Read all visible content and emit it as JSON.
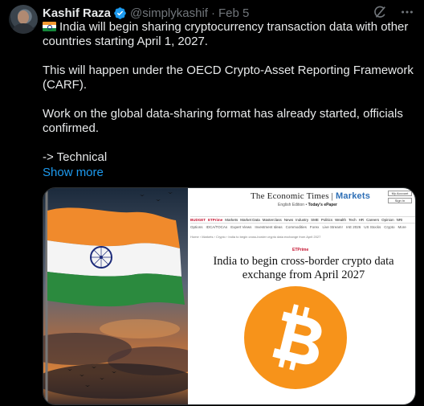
{
  "author": {
    "name": "Kashif Raza",
    "handle": "@simplykashif",
    "separator": "·",
    "date": "Feb 5"
  },
  "tweet": {
    "line1": "India will begin sharing cryptocurrency transaction data with other countries starting April 1, 2027.",
    "line2": "This will happen under the OECD Crypto-Asset Reporting Framework (CARF).",
    "line3": "Work on the global data-sharing format has already started, officials confirmed.",
    "line4": "-> Technical",
    "show_more": "Show more"
  },
  "icons": {
    "verified": "verified-badge-icon",
    "grok": "grok-icon",
    "more": "more-icon",
    "flag": "india-flag-emoji"
  },
  "embedded_article": {
    "publication": "The Economic Times",
    "section": "Markets",
    "edition": "English Edition",
    "epaper": "Today's ePaper",
    "nav": [
      "BUDGET",
      "ETPrime",
      "Markets",
      "Market Data",
      "Masterclass",
      "News",
      "Industry",
      "SME",
      "Politics",
      "Wealth",
      "Tech",
      "HR",
      "Careers",
      "Opinion",
      "NRI"
    ],
    "subnav": [
      "Options",
      "IDCA/TOCAs",
      "Expert Views",
      "Investment Ideas",
      "Commodities",
      "Forex",
      "Live Stream!",
      "IAE 2026",
      "US Stocks",
      "Crypto",
      "More"
    ],
    "breadcrumb": "Home › Markets › Crypto › India to begin cross-border crypto data exchange from April 2027",
    "prime_label": "ETPrime",
    "headline": "India to begin cross-border crypto data exchange from April 2027",
    "buttons": [
      "My Account",
      "Sign In"
    ]
  },
  "colors": {
    "accent": "#1d9bf0",
    "verified": "#1d9bf0",
    "bitcoin": "#f7931a"
  }
}
